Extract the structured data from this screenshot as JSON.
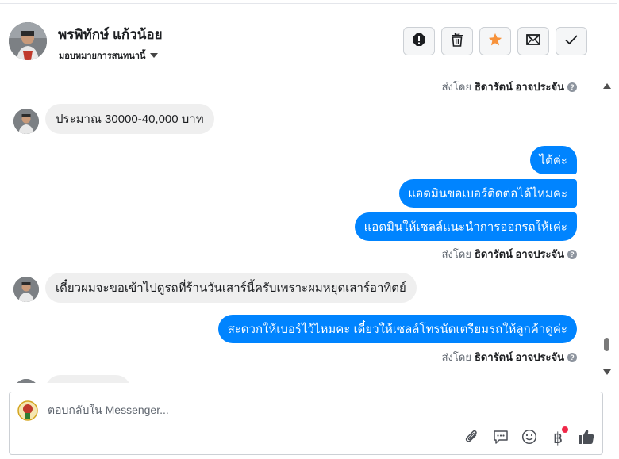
{
  "header": {
    "contact_name": "พรพิทักษ์ แก้วน้อย",
    "assign_label": "มอบหมายการสนทนานี้",
    "actions": [
      {
        "name": "spam-button",
        "icon": "exclamation-icon"
      },
      {
        "name": "delete-button",
        "icon": "trash-icon"
      },
      {
        "name": "star-button",
        "icon": "star-icon"
      },
      {
        "name": "unread-button",
        "icon": "envelope-icon"
      },
      {
        "name": "done-button",
        "icon": "check-icon"
      }
    ]
  },
  "conversation": {
    "sent_by_prefix": "ส่งโดย",
    "sent_by_name": "ธิดารัตน์ อาจประจัน",
    "help_glyph": "?",
    "messages": {
      "in_1": "ประมาณ 30000-40,000 บาท",
      "out_1": "ได้ค่ะ",
      "out_2": "แอดมินขอเบอร์ติดต่อได้ไหมคะ",
      "out_3": "แอดมินให้เซลล์แนะนำการออกรถให้เค่ะ",
      "in_2": "เดี๋ยวผมจะขอเข้าไปดูรถที่ร้านวันเสาร์นี้ครับเพราะผมหยุดเสาร์อาทิตย์",
      "out_4": "สะดวกให้เบอร์ไว้ไหมคะ เดี๋ยวให้เซลล์โทรนัดเตรียมรถให้ลูกค้าดูค่ะ"
    }
  },
  "composer": {
    "placeholder": "ตอบกลับใน Messenger...",
    "baht_glyph": "฿",
    "tools": [
      "paperclip-icon",
      "saved-reply-icon",
      "emoji-icon",
      "baht-icon",
      "like-icon"
    ]
  },
  "colors": {
    "accent": "#0084ff",
    "incoming_bubble": "#efefef",
    "star": "#f7923b",
    "notification": "#f02849"
  }
}
